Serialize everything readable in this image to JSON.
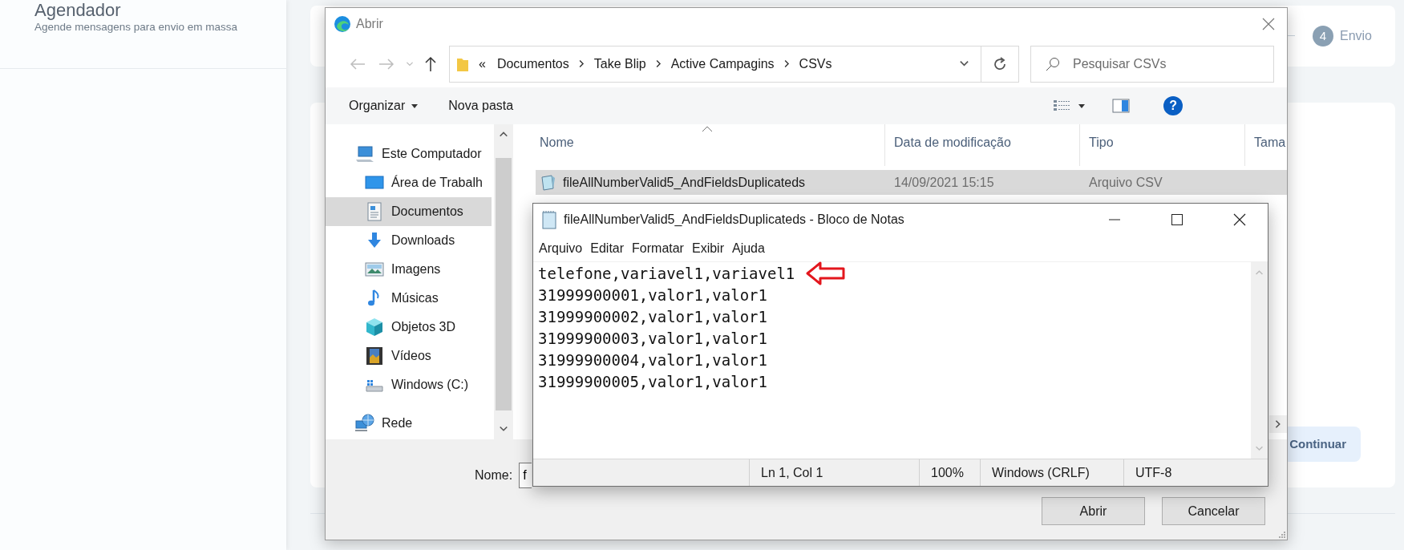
{
  "app": {
    "section_title": "Agendador",
    "section_subtitle": "Agende mensagens para envio em massa",
    "step": {
      "number": "4",
      "label": "Envio"
    },
    "continue_button": "Continuar"
  },
  "open_dialog": {
    "title": "Abrir",
    "overflow_mark": "«",
    "path": [
      "Documentos",
      "Take Blip",
      "Active Campagins",
      "CSVs"
    ],
    "search_placeholder": "Pesquisar CSVs",
    "toolbar": [
      {
        "label": "Organizar",
        "kind": "dropdown"
      },
      {
        "label": "Nova pasta",
        "kind": "button"
      }
    ],
    "help_glyph": "?",
    "nav": [
      {
        "label": "Este Computador",
        "kind": "computer",
        "selected": false,
        "children": [
          {
            "label": "Área de Trabalh",
            "kind": "desktop",
            "selected": false
          },
          {
            "label": "Documentos",
            "kind": "documents",
            "selected": true
          },
          {
            "label": "Downloads",
            "kind": "downloads",
            "selected": false
          },
          {
            "label": "Imagens",
            "kind": "pictures",
            "selected": false
          },
          {
            "label": "Músicas",
            "kind": "music",
            "selected": false
          },
          {
            "label": "Objetos 3D",
            "kind": "cube",
            "selected": false
          },
          {
            "label": "Vídeos",
            "kind": "videos",
            "selected": false
          },
          {
            "label": "Windows (C:)",
            "kind": "drive",
            "selected": false
          }
        ]
      },
      {
        "label": "Rede",
        "kind": "network",
        "selected": false
      }
    ],
    "columns": [
      "Nome",
      "Data de modificação",
      "Tipo",
      "Tama"
    ],
    "files": [
      {
        "name": "fileAllNumberValid5_AndFieldsDuplicateds",
        "modified": "14/09/2021 15:15",
        "type": "Arquivo CSV",
        "selected": true
      }
    ],
    "filename_label": "Nome:",
    "filename_value": "f",
    "buttons": [
      "Abrir",
      "Cancelar"
    ]
  },
  "notepad": {
    "title": "fileAllNumberValid5_AndFieldsDuplicateds - Bloco de Notas",
    "menu": [
      "Arquivo",
      "Editar",
      "Formatar",
      "Exibir",
      "Ajuda"
    ],
    "lines": [
      {
        "text": "telefone,variavel1,variavel1",
        "marked": true
      },
      {
        "text": "31999900001,valor1,valor1",
        "marked": false
      },
      {
        "text": "31999900002,valor1,valor1",
        "marked": false
      },
      {
        "text": "31999900003,valor1,valor1",
        "marked": false
      },
      {
        "text": "31999900004,valor1,valor1",
        "marked": false
      },
      {
        "text": "31999900005,valor1,valor1",
        "marked": false
      }
    ],
    "status": [
      "Ln 1, Col 1",
      "100%",
      "Windows (CRLF)",
      "UTF-8"
    ]
  }
}
